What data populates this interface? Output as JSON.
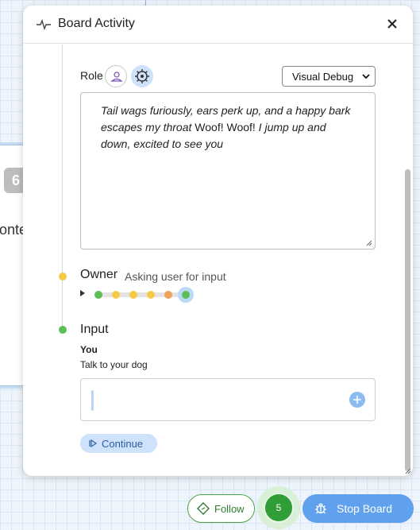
{
  "background": {
    "node_badge": "6",
    "node_text_fragment": "onte"
  },
  "panel": {
    "title": "Board Activity",
    "title_icon": "activity-pulse-icon",
    "close_icon": "close-icon"
  },
  "role": {
    "label": "Role",
    "user_icon": "user-role-icon",
    "gear_icon": "gear-icon",
    "selected_option": "Visual Debug"
  },
  "textbox": {
    "parts": [
      {
        "text": "Tail wags furiously, ears perk up, and a happy bark escapes my throat ",
        "italic": true
      },
      {
        "text": "Woof! Woof!",
        "italic": false
      },
      {
        "text": " I jump up and down, excited to see you",
        "italic": true
      }
    ]
  },
  "owner": {
    "title": "Owner",
    "status": "Asking user for input",
    "status_color": "#f8c946"
  },
  "progress": {
    "dot_colors": [
      "#5cbf55",
      "#f8c946",
      "#f8c946",
      "#f8c946",
      "#f2a25a",
      "#5cbf55"
    ],
    "active_index": 5
  },
  "input": {
    "title": "Input",
    "status_color": "#5cbf55",
    "speaker": "You",
    "prompt": "Talk to your dog",
    "value": "",
    "add_icon": "add-circle-icon"
  },
  "continue_button": {
    "label": "Continue",
    "icon": "step-forward-icon"
  },
  "controls": {
    "follow_label": "Follow",
    "follow_icon": "follow-diamond-icon",
    "counter": "5",
    "stop_label": "Stop Board",
    "stop_icon": "bug-icon"
  },
  "colors": {
    "accent": "#5fa1ec",
    "success": "#2f9e36",
    "warning": "#f8c946"
  }
}
